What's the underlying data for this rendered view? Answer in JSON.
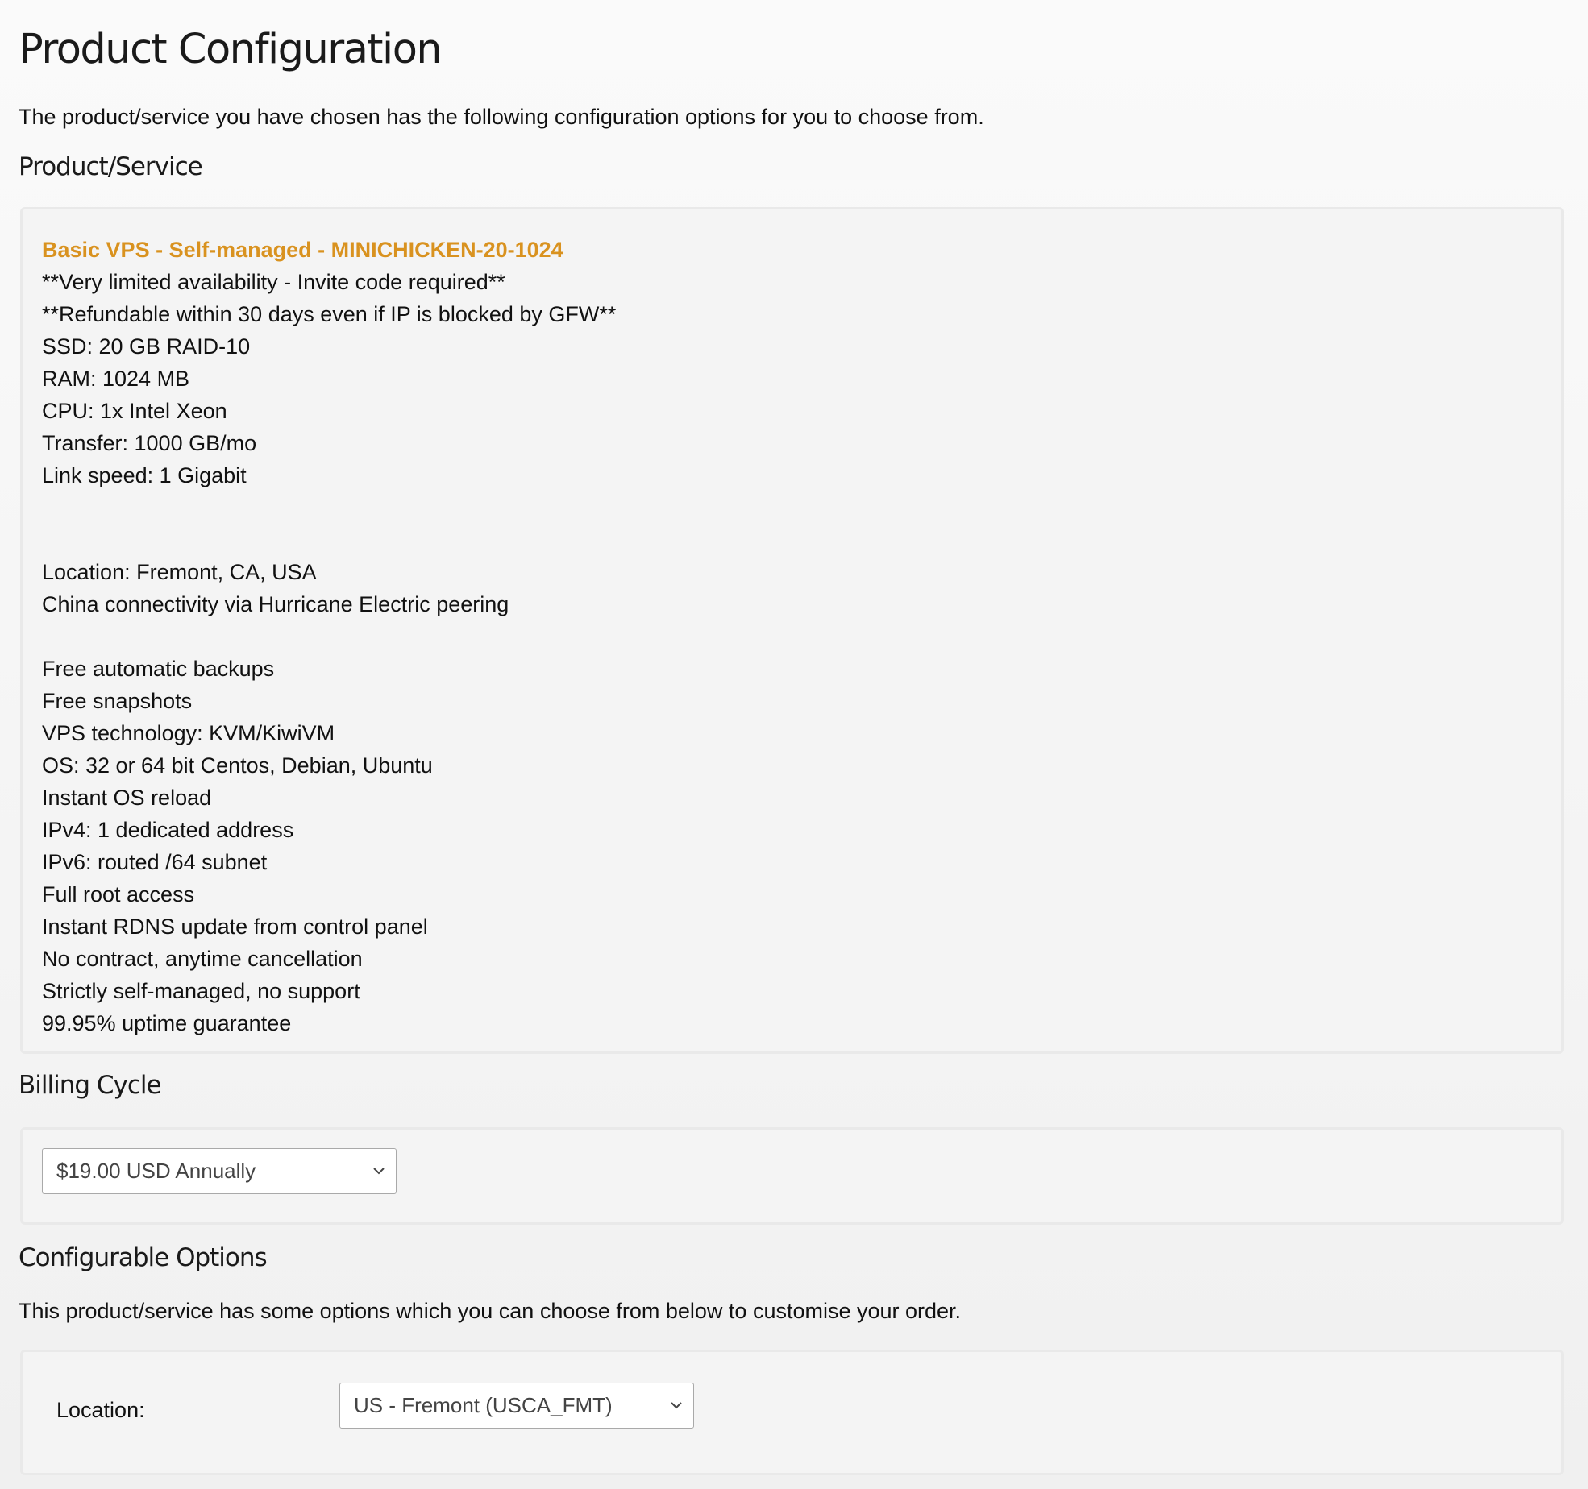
{
  "page": {
    "title": "Product Configuration",
    "intro": "The product/service you have chosen has the following configuration options for you to choose from."
  },
  "product_section": {
    "heading": "Product/Service",
    "name": "Basic VPS - Self-managed - MINICHICKEN-20-1024",
    "name_color": "#d9921f",
    "description_lines": [
      "**Very limited availability - Invite code required**",
      "**Refundable within 30 days even if IP is blocked by GFW**",
      "SSD: 20 GB RAID-10",
      "RAM: 1024 MB",
      "CPU: 1x Intel Xeon",
      "Transfer: 1000 GB/mo",
      "Link speed: 1 Gigabit",
      "",
      "",
      "Location: Fremont, CA, USA",
      "China connectivity via Hurricane Electric peering",
      "",
      "Free automatic backups",
      "Free snapshots",
      "VPS technology: KVM/KiwiVM",
      "OS: 32 or 64 bit Centos, Debian, Ubuntu",
      "Instant OS reload",
      "IPv4: 1 dedicated address",
      "IPv6: routed /64 subnet",
      "Full root access",
      "Instant RDNS update from control panel",
      "No contract, anytime cancellation",
      "Strictly self-managed, no support",
      "99.95% uptime guarantee"
    ]
  },
  "billing_section": {
    "heading": "Billing Cycle",
    "selected": "$19.00 USD Annually",
    "icon": "chevron-down-icon"
  },
  "configurable_section": {
    "heading": "Configurable Options",
    "intro": "This product/service has some options which you can choose from below to customise your order.",
    "location_label": "Location:",
    "location_selected": "US - Fremont (USCA_FMT)",
    "icon": "chevron-down-icon"
  }
}
